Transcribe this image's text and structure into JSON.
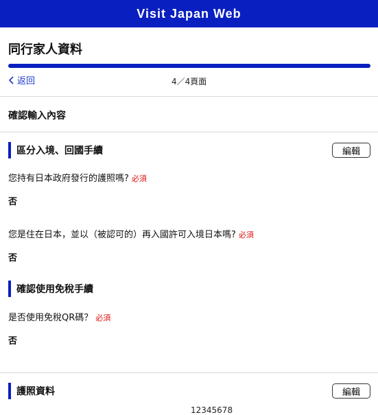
{
  "header": {
    "title": "Visit Japan Web"
  },
  "page": {
    "title": "同行家人資料",
    "progress_percent": 100,
    "back_label": "返回",
    "page_indicator": "4／4頁面"
  },
  "confirm_heading": "確認輸入內容",
  "sections": [
    {
      "title": "區分入境、回國手續",
      "edit_label": "編輯",
      "questions": [
        {
          "text": "您持有日本政府發行的護照嗎?",
          "required": "必須",
          "answer": "否"
        },
        {
          "text": "您是住在日本，並以（被認可的）再入國許可入境日本嗎?",
          "required": "必須",
          "answer": "否"
        }
      ]
    },
    {
      "title": "確認使用免稅手續",
      "questions": [
        {
          "text": "是否使用免稅QR碼？",
          "required": "必須",
          "answer": "否"
        }
      ]
    },
    {
      "title": "護照資料",
      "edit_label": "編輯",
      "partial_text": "12345678"
    }
  ],
  "colors": {
    "brand": "#0a1fc0",
    "required": "#d11111",
    "link": "#1a37c8"
  }
}
